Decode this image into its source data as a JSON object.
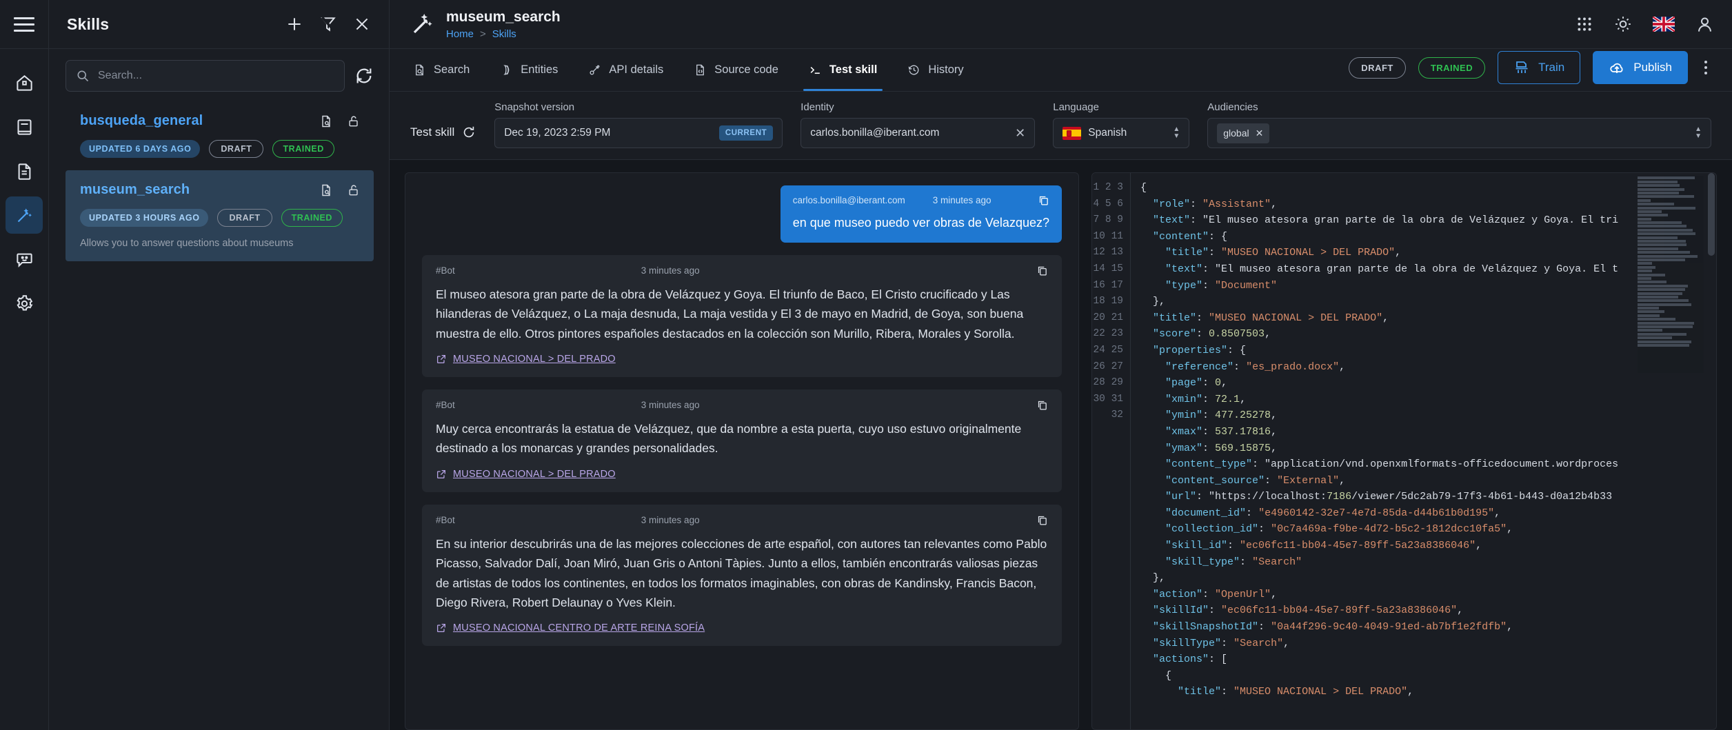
{
  "rail": {
    "menu_icon": "hamburger-icon",
    "items": [
      {
        "name": "home",
        "icon": "home-icon",
        "active": false
      },
      {
        "name": "library",
        "icon": "book-icon",
        "active": false
      },
      {
        "name": "documents",
        "icon": "document-icon",
        "active": false
      },
      {
        "name": "skills",
        "icon": "magic-wand-icon",
        "active": true
      },
      {
        "name": "chat",
        "icon": "chat-smiley-icon",
        "active": false
      },
      {
        "name": "settings",
        "icon": "gear-icon",
        "active": false
      }
    ]
  },
  "skills_panel": {
    "title": "Skills",
    "actions": [
      "add-icon",
      "filter-off-icon",
      "close-icon"
    ],
    "search": {
      "placeholder": "Search...",
      "value": ""
    },
    "refresh_icon": "refresh-icon",
    "items": [
      {
        "name": "busqueda_general",
        "updated": "UPDATED 6 DAYS AGO",
        "status": "DRAFT",
        "trained": "TRAINED",
        "description": "",
        "selected": false
      },
      {
        "name": "museum_search",
        "updated": "UPDATED 3 HOURS AGO",
        "status": "DRAFT",
        "trained": "TRAINED",
        "description": "Allows you to answer questions about museums",
        "selected": true
      }
    ]
  },
  "topbar": {
    "icon": "magic-wand-icon",
    "title": "museum_search",
    "breadcrumb": [
      "Home",
      "Skills"
    ],
    "breadcrumb_separator": ">",
    "right_icons": [
      "apps-grid-icon",
      "brightness-icon",
      "flag-uk-icon",
      "user-account-icon"
    ]
  },
  "tabs": [
    {
      "label": "Search",
      "icon": "search-doc-icon",
      "active": false
    },
    {
      "label": "Entities",
      "icon": "entities-icon",
      "active": false
    },
    {
      "label": "API details",
      "icon": "api-icon",
      "active": false
    },
    {
      "label": "Source code",
      "icon": "source-code-icon",
      "active": false
    },
    {
      "label": "Test skill",
      "icon": "terminal-icon",
      "active": true
    },
    {
      "label": "History",
      "icon": "history-clock-icon",
      "active": false
    }
  ],
  "tabbar_actions": {
    "draft_pill": "DRAFT",
    "trained_pill": "TRAINED",
    "train_button": "Train",
    "train_icon": "train-model-icon",
    "publish_button": "Publish",
    "publish_icon": "cloud-upload-icon",
    "overflow_icon": "kebab-menu-icon"
  },
  "config": {
    "test_skill_label": "Test skill",
    "reload_icon": "reload-icon",
    "snapshot": {
      "label": "Snapshot version",
      "value": "Dec 19, 2023 2:59 PM",
      "chip": "CURRENT"
    },
    "identity": {
      "label": "Identity",
      "value": "carlos.bonilla@iberant.com",
      "clear_icon": "close-icon"
    },
    "language": {
      "label": "Language",
      "value": "Spanish",
      "flag": "flag-spain-icon"
    },
    "audiences": {
      "label": "Audiencies",
      "tags": [
        "global"
      ],
      "tag_remove_icon": "close-icon"
    }
  },
  "chat": {
    "messages": [
      {
        "role": "user",
        "who": "carlos.bonilla@iberant.com",
        "when": "3 minutes ago",
        "text": "en que museo puedo ver obras de Velazquez?",
        "copy_icon": "copy-icon",
        "source": null
      },
      {
        "role": "bot",
        "who": "#Bot",
        "when": "3 minutes ago",
        "text": "El museo atesora gran parte de la obra de Velázquez y Goya. El triunfo de Baco, El Cristo crucificado y Las hilanderas de Velázquez, o La maja desnuda, La maja vestida y El 3 de mayo en Madrid, de Goya, son buena muestra de ello. Otros pintores españoles destacados en la colección son Murillo, Ribera, Morales y Sorolla.",
        "copy_icon": "copy-icon",
        "source": "MUSEO NACIONAL > DEL PRADO",
        "source_icon": "external-link-icon"
      },
      {
        "role": "bot",
        "who": "#Bot",
        "when": "3 minutes ago",
        "text": "Muy cerca encontrarás la estatua de Velázquez, que da nombre a esta puerta, cuyo uso estuvo originalmente destinado a los monarcas y grandes personalidades.",
        "copy_icon": "copy-icon",
        "source": "MUSEO NACIONAL > DEL PRADO",
        "source_icon": "external-link-icon"
      },
      {
        "role": "bot",
        "who": "#Bot",
        "when": "3 minutes ago",
        "text": "En su interior descubrirás una de las mejores colecciones de arte español, con autores tan relevantes como Pablo Picasso, Salvador Dalí, Joan Miró, Juan Gris o Antoni Tàpies. Junto a ellos, también encontrarás valiosas piezas de artistas de todos los continentes, en todos los formatos imaginables, con obras de Kandinsky, Francis Bacon, Diego Rivera, Robert Delaunay o Yves Klein.",
        "copy_icon": "copy-icon",
        "source": "MUSEO NACIONAL CENTRO DE ARTE REINA SOFÍA",
        "source_icon": "external-link-icon"
      }
    ]
  },
  "code_panel": {
    "first_line": 1,
    "last_line": 32,
    "lines": [
      "{",
      "  \"role\": \"Assistant\",",
      "  \"text\": \"El museo atesora gran parte de la obra de Velázquez y Goya. El tri",
      "  \"content\": {",
      "    \"title\": \"MUSEO NACIONAL > DEL PRADO\",",
      "    \"text\": \"El museo atesora gran parte de la obra de Velázquez y Goya. El t",
      "    \"type\": \"Document\"",
      "  },",
      "  \"title\": \"MUSEO NACIONAL > DEL PRADO\",",
      "  \"score\": 0.8507503,",
      "  \"properties\": {",
      "    \"reference\": \"es_prado.docx\",",
      "    \"page\": 0,",
      "    \"xmin\": 72.1,",
      "    \"ymin\": 477.25278,",
      "    \"xmax\": 537.17816,",
      "    \"ymax\": 569.15875,",
      "    \"content_type\": \"application/vnd.openxmlformats-officedocument.wordproces",
      "    \"content_source\": \"External\",",
      "    \"url\": \"https://localhost:7186/viewer/5dc2ab79-17f3-4b61-b443-d0a12b4b33",
      "    \"document_id\": \"e4960142-32e7-4e7d-85da-d44b61b0d195\",",
      "    \"collection_id\": \"0c7a469a-f9be-4d72-b5c2-1812dcc10fa5\",",
      "    \"skill_id\": \"ec06fc11-bb04-45e7-89ff-5a23a8386046\",",
      "    \"skill_type\": \"Search\"",
      "  },",
      "  \"action\": \"OpenUrl\",",
      "  \"skillId\": \"ec06fc11-bb04-45e7-89ff-5a23a8386046\",",
      "  \"skillSnapshotId\": \"0a44f296-9c40-4049-91ed-ab7bf1e2fdfb\",",
      "  \"skillType\": \"Search\",",
      "  \"actions\": [",
      "    {",
      "      \"title\": \"MUSEO NACIONAL > DEL PRADO\","
    ]
  }
}
